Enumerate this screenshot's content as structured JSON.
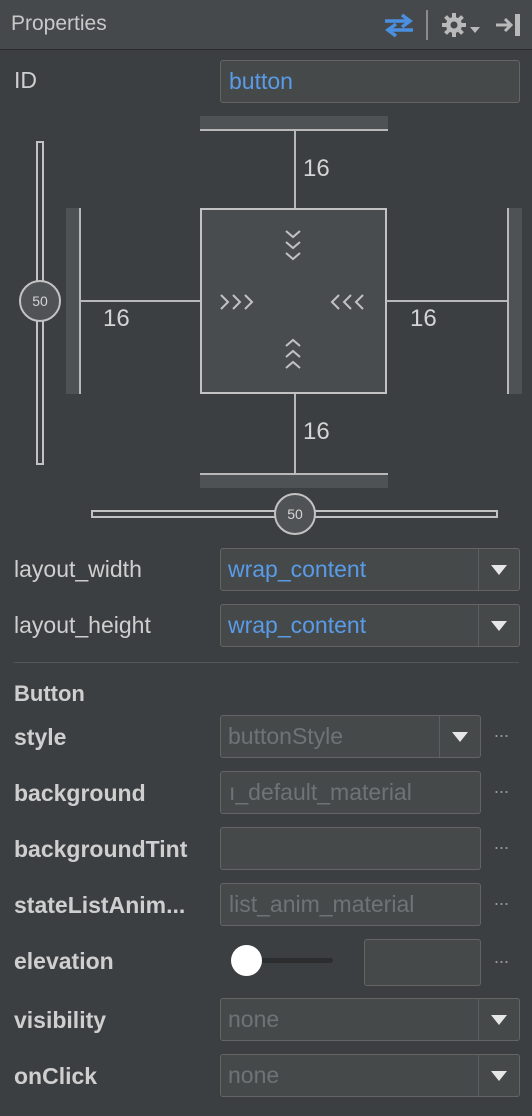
{
  "panel": {
    "title": "Properties",
    "icons": {
      "swap": "swap-arrows-icon",
      "settings": "gear-icon",
      "settings_menu": "chevron-down-icon",
      "pin": "pin-to-side-icon"
    },
    "accent_color": "#5a9be8"
  },
  "id_row": {
    "label": "ID",
    "value": "button"
  },
  "constraint": {
    "margin_top": "16",
    "margin_left": "16",
    "margin_right": "16",
    "margin_bottom": "16",
    "vertical_bias": "50",
    "horizontal_bias": "50"
  },
  "layout": {
    "width_label": "layout_width",
    "width_value": "wrap_content",
    "height_label": "layout_height",
    "height_value": "wrap_content"
  },
  "section": {
    "title": "Button"
  },
  "attrs": {
    "style_label": "style",
    "style_value": "buttonStyle",
    "background_label": "background",
    "background_value": "ı_default_material",
    "background_tint_label": "backgroundTint",
    "background_tint_value": "",
    "state_list_label": "stateListAnim...",
    "state_list_value": "list_anim_material",
    "elevation_label": "elevation",
    "elevation_value": "",
    "visibility_label": "visibility",
    "visibility_value": "none",
    "onclick_label": "onClick",
    "onclick_value": "none",
    "more_label": "···"
  }
}
